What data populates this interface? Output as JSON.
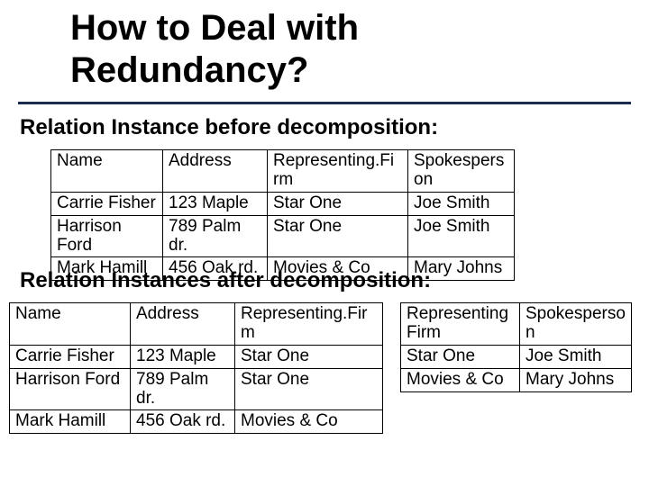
{
  "title_line1": "How to Deal with",
  "title_line2": "Redundancy?",
  "heading_before": "Relation Instance before decomposition:",
  "heading_after": "Relation Instances after decomposition:",
  "t1": {
    "h1": "Name",
    "h2": "Address",
    "h3": "Representing.Fi rm",
    "h4": "Spokespers on",
    "r1c1": "Carrie Fisher",
    "r1c2": "123 Maple",
    "r1c3": "Star One",
    "r1c4": "Joe Smith",
    "r2c1": "Harrison Ford",
    "r2c2": "789 Palm dr.",
    "r2c3": "Star One",
    "r2c4": "Joe Smith",
    "r3c1": "Mark Hamill",
    "r3c2": "456 Oak rd.",
    "r3c3": "Movies & Co",
    "r3c4": "Mary Johns"
  },
  "t2": {
    "h1": "Name",
    "h2": "Address",
    "h3": "Representing.Fir m",
    "r1c1": "Carrie Fisher",
    "r1c2": "123 Maple",
    "r1c3": "Star One",
    "r2c1": "Harrison Ford",
    "r2c2": "789 Palm dr.",
    "r2c3": "Star One",
    "r3c1": "Mark Hamill",
    "r3c2": "456 Oak rd.",
    "r3c3": "Movies & Co"
  },
  "t3": {
    "h1": "Representing Firm",
    "h2": "Spokesperso n",
    "r1c1": "Star One",
    "r1c2": "Joe Smith",
    "r2c1": "Movies & Co",
    "r2c2": "Mary Johns"
  }
}
